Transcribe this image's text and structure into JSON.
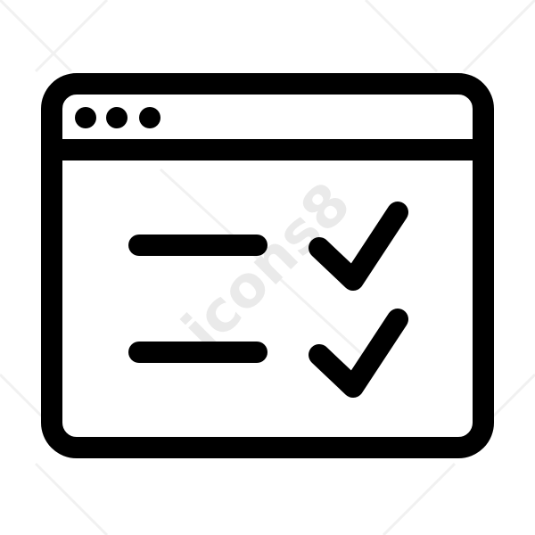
{
  "icon": {
    "name": "browser-checklist-icon",
    "stroke_color": "#000000",
    "background_color": "#ffffff"
  },
  "window": {
    "dots": [
      "window-dot",
      "window-dot",
      "window-dot"
    ]
  },
  "checklist": {
    "items": [
      {
        "checked": true
      },
      {
        "checked": true
      }
    ]
  },
  "watermark": {
    "text": "icons8",
    "color": "#d9d9d9"
  }
}
